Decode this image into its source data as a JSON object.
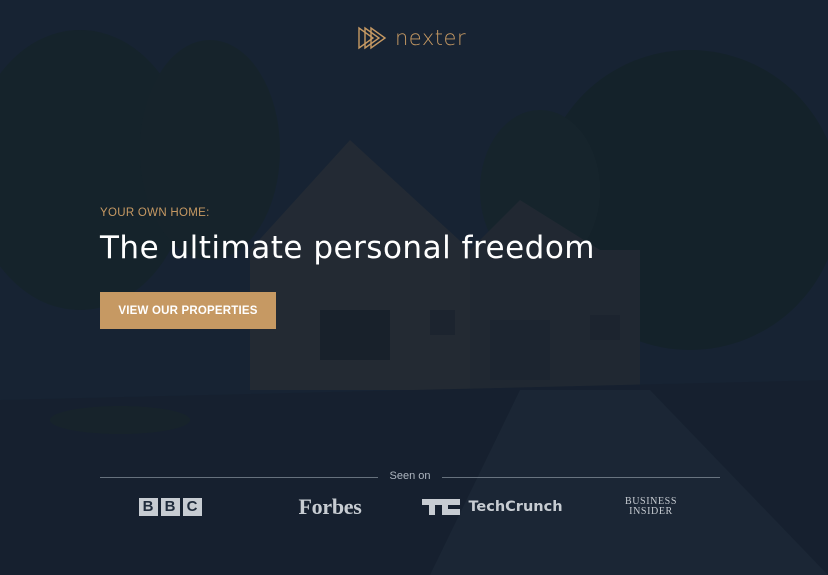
{
  "brand": {
    "name": "nexter",
    "logo_icon": "triple-triangle-play-icon",
    "accent": "#c69963"
  },
  "hero": {
    "subtitle": "YOUR OWN HOME:",
    "headline": "The ultimate personal freedom",
    "cta_label": "VIEW OUR PROPERTIES"
  },
  "press": {
    "label": "Seen on",
    "logos": [
      {
        "name": "BBC",
        "letters": [
          "B",
          "B",
          "C"
        ]
      },
      {
        "name": "Forbes"
      },
      {
        "name": "TechCrunch"
      },
      {
        "name_line1": "BUSINESS",
        "name_line2": "INSIDER"
      }
    ]
  }
}
